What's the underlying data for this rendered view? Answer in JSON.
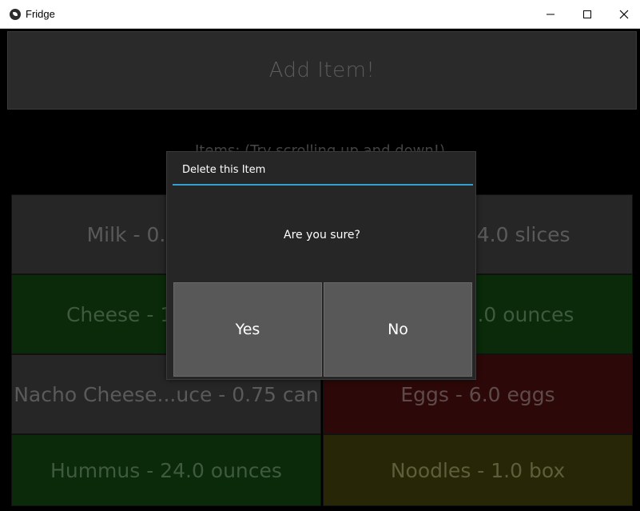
{
  "window": {
    "title": "Fridge",
    "controls": [
      "minimize",
      "maximize",
      "close"
    ]
  },
  "app": {
    "add_item_label": "Add Item!",
    "items_label": "Items: (Try scrolling up and down!)",
    "items": [
      {
        "text": "Milk - 0.5 gallon",
        "color": "#262626"
      },
      {
        "text": "Bread - 24.0 slices",
        "color": "#262626"
      },
      {
        "text": "Cheese - 16.0 slices",
        "color": "#0a2a0a"
      },
      {
        "text": "Yogurt - 6.0 ounces",
        "color": "#0a2a0a"
      },
      {
        "text": "Nacho Cheese...uce - 0.75 can",
        "color": "#262626"
      },
      {
        "text": "Eggs - 6.0 eggs",
        "color": "#2d0808"
      },
      {
        "text": "Hummus - 24.0 ounces",
        "color": "#0a2a0a"
      },
      {
        "text": "Noodles - 1.0 box",
        "color": "#272708"
      }
    ]
  },
  "dialog": {
    "title": "Delete this Item",
    "message": "Are you sure?",
    "yes_label": "Yes",
    "no_label": "No",
    "accent_color": "#33a1d0"
  }
}
